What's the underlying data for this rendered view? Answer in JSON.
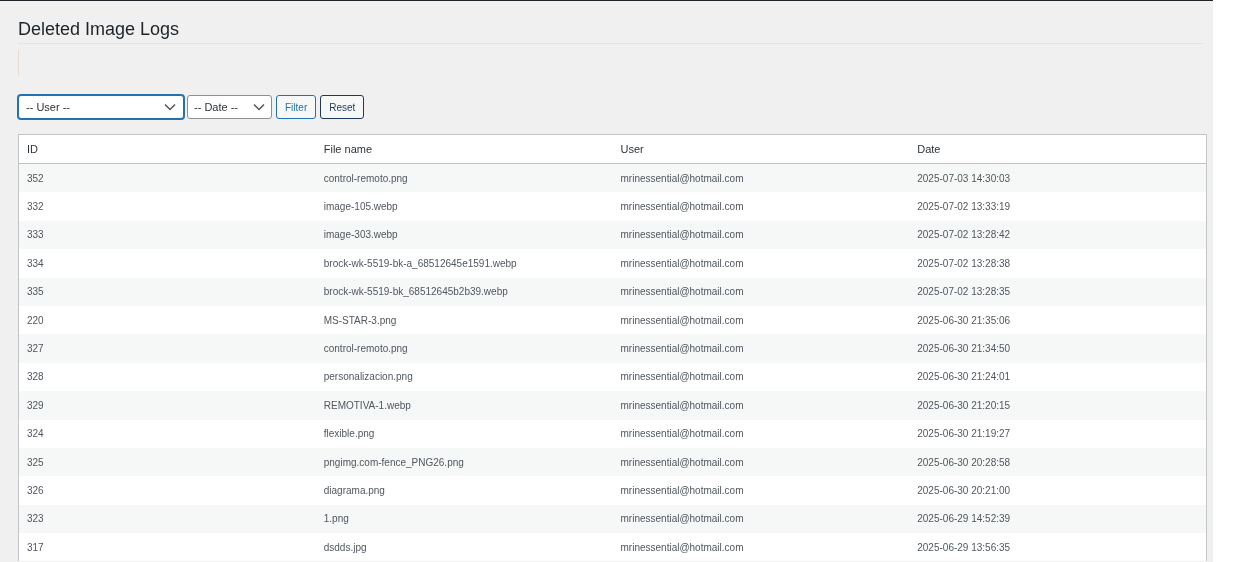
{
  "title": "Deleted Image Logs",
  "filters": {
    "user_select": "-- User --",
    "date_select": "-- Date --",
    "buttons": [
      "Filter",
      "Reset"
    ]
  },
  "table": {
    "columns": [
      "ID",
      "File name",
      "User",
      "Date"
    ],
    "rows": [
      [
        "352",
        "control-remoto.png",
        "mrinessential@hotmail.com",
        "2025-07-03 14:30:03"
      ],
      [
        "332",
        "image-105.webp",
        "mrinessential@hotmail.com",
        "2025-07-02 13:33:19"
      ],
      [
        "333",
        "image-303.webp",
        "mrinessential@hotmail.com",
        "2025-07-02 13:28:42"
      ],
      [
        "334",
        "brock-wk-5519-bk-a_68512645e1591.webp",
        "mrinessential@hotmail.com",
        "2025-07-02 13:28:38"
      ],
      [
        "335",
        "brock-wk-5519-bk_68512645b2b39.webp",
        "mrinessential@hotmail.com",
        "2025-07-02 13:28:35"
      ],
      [
        "220",
        "MS-STAR-3.png",
        "mrinessential@hotmail.com",
        "2025-06-30 21:35:06"
      ],
      [
        "327",
        "control-remoto.png",
        "mrinessential@hotmail.com",
        "2025-06-30 21:34:50"
      ],
      [
        "328",
        "personalizacion.png",
        "mrinessential@hotmail.com",
        "2025-06-30 21:24:01"
      ],
      [
        "329",
        "REMOTIVA-1.webp",
        "mrinessential@hotmail.com",
        "2025-06-30 21:20:15"
      ],
      [
        "324",
        "flexible.png",
        "mrinessential@hotmail.com",
        "2025-06-30 21:19:27"
      ],
      [
        "325",
        "pngimg.com-fence_PNG26.png",
        "mrinessential@hotmail.com",
        "2025-06-30 20:28:58"
      ],
      [
        "326",
        "diagrama.png",
        "mrinessential@hotmail.com",
        "2025-06-30 20:21:00"
      ],
      [
        "323",
        "1.png",
        "mrinessential@hotmail.com",
        "2025-06-29 14:52:39"
      ],
      [
        "317",
        "dsdds.jpg",
        "mrinessential@hotmail.com",
        "2025-06-29 13:56:35"
      ]
    ]
  }
}
